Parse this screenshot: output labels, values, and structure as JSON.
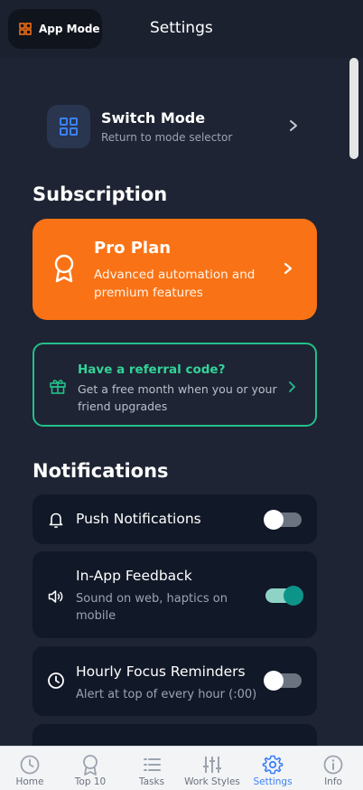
{
  "header": {
    "mode_button_label": "App Mode",
    "title": "Settings"
  },
  "switch_mode": {
    "title": "Switch Mode",
    "subtitle": "Return to mode selector"
  },
  "subscription": {
    "heading": "Subscription",
    "plan_title": "Pro Plan",
    "plan_subtitle": "Advanced automation and premium features"
  },
  "referral": {
    "title": "Have a referral code?",
    "subtitle": "Get a free month when you or your friend upgrades"
  },
  "notifications": {
    "heading": "Notifications",
    "items": [
      {
        "title": "Push Notifications",
        "subtitle": "",
        "enabled": false
      },
      {
        "title": "In-App Feedback",
        "subtitle": "Sound on web, haptics on mobile",
        "enabled": true
      },
      {
        "title": "Hourly Focus Reminders",
        "subtitle": "Alert at top of every hour (:00)",
        "enabled": false
      }
    ]
  },
  "bottom_nav": {
    "items": [
      {
        "label": "Home",
        "icon": "clock-icon",
        "active": false
      },
      {
        "label": "Top 10",
        "icon": "award-icon",
        "active": false
      },
      {
        "label": "Tasks",
        "icon": "list-icon",
        "active": false
      },
      {
        "label": "Work Styles",
        "icon": "sliders-icon",
        "active": false
      },
      {
        "label": "Settings",
        "icon": "gear-icon",
        "active": true
      },
      {
        "label": "Info",
        "icon": "info-icon",
        "active": false
      }
    ]
  },
  "colors": {
    "background": "#1e2433",
    "card": "#111827",
    "pro_plan": "#f97316",
    "referral_accent": "#22c08a",
    "toggle_on": "#0d9488",
    "nav_active": "#3b82f6"
  }
}
